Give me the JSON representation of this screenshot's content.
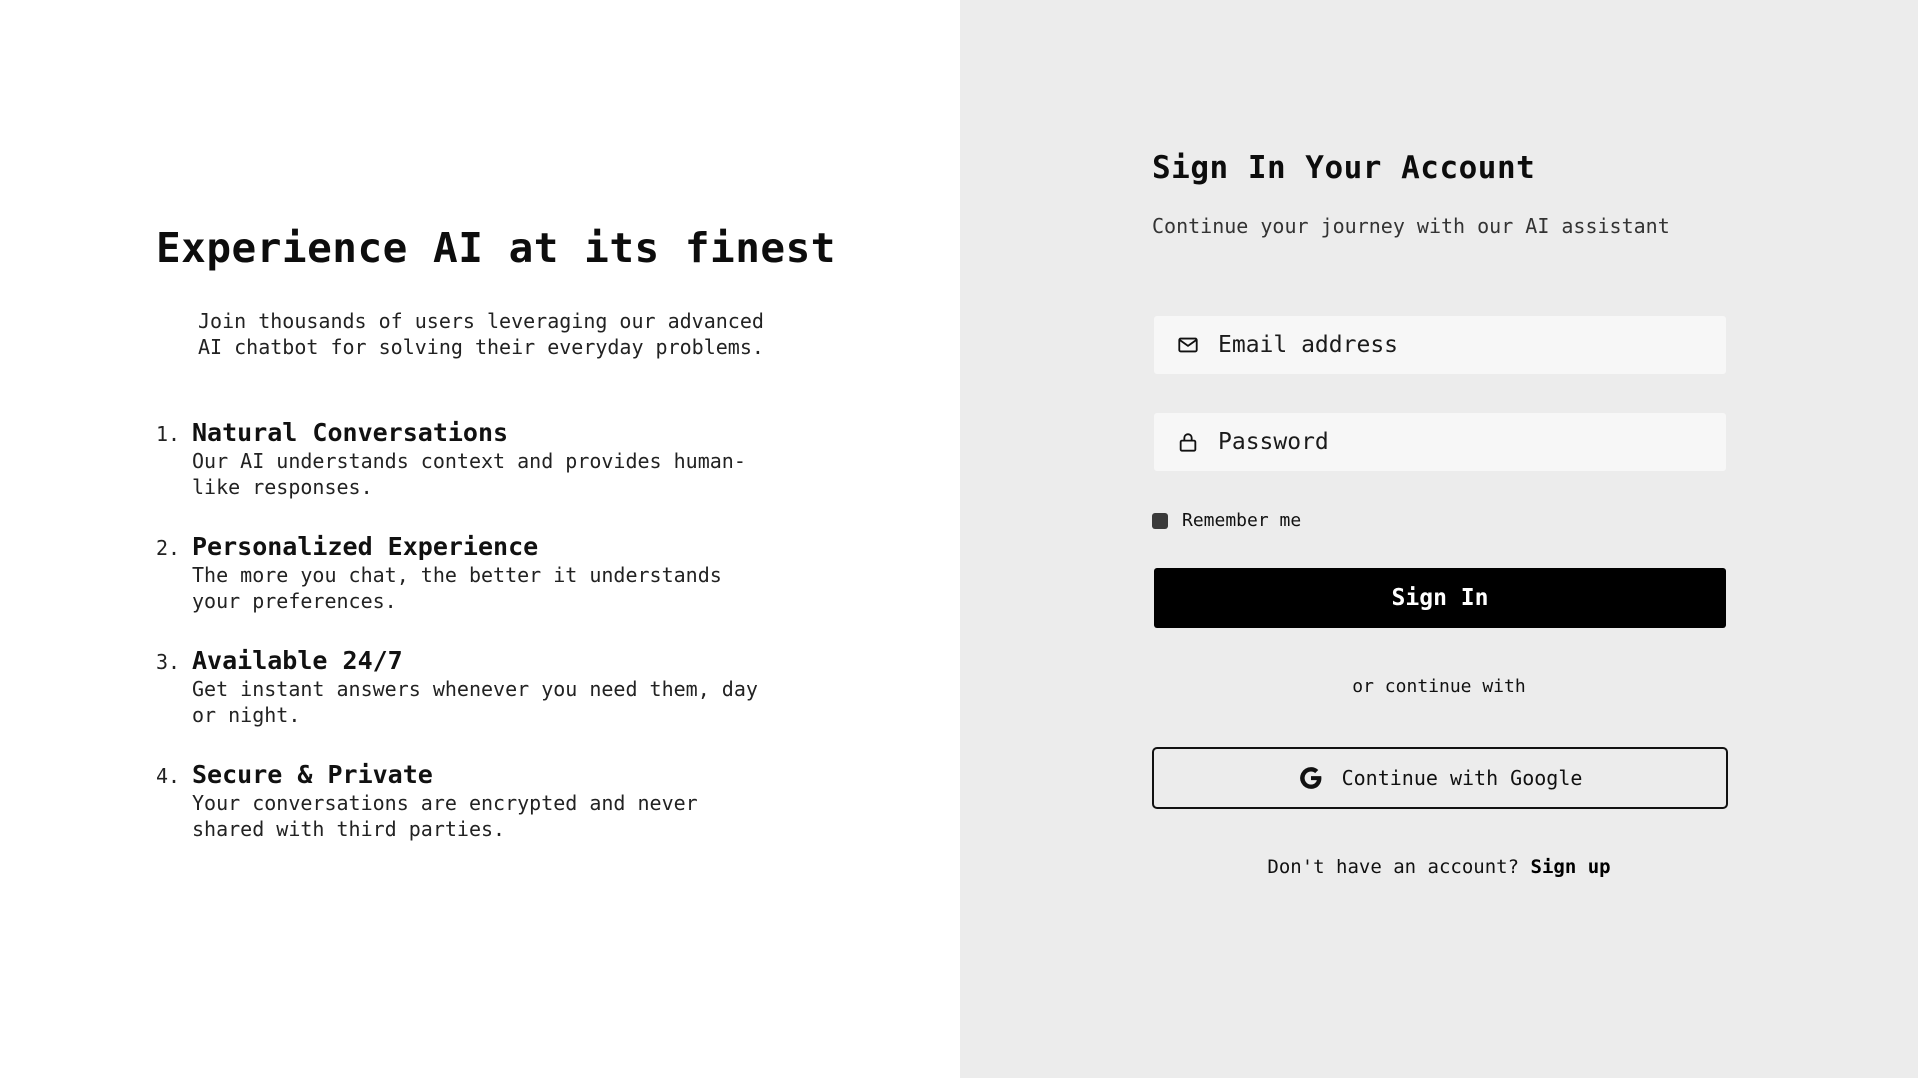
{
  "hero": {
    "title": "Experience AI at its finest",
    "subtitle": "Join thousands of users leveraging our advanced AI chatbot for solving their everyday problems."
  },
  "features": [
    {
      "number": "1.",
      "title": "Natural Conversations",
      "description": "Our AI understands context and provides human-like responses."
    },
    {
      "number": "2.",
      "title": "Personalized Experience",
      "description": "The more you chat, the better it understands your preferences."
    },
    {
      "number": "3.",
      "title": "Available 24/7",
      "description": "Get instant answers whenever you need them, day or night."
    },
    {
      "number": "4.",
      "title": "Secure & Private",
      "description": "Your conversations are encrypted and never shared with third parties."
    }
  ],
  "signin": {
    "title": "Sign In Your Account",
    "subtitle": "Continue your journey with our AI assistant",
    "email_placeholder": "Email address",
    "email_value": "",
    "password_placeholder": "Password",
    "password_value": "",
    "remember_label": "Remember me",
    "remember_checked": true,
    "submit_label": "Sign In",
    "divider_text": "or continue with",
    "google_label": "Continue with Google",
    "signup_prompt": "Don't have an account?",
    "signup_link": "Sign up"
  },
  "icons": {
    "email": "mail-icon",
    "password": "lock-icon",
    "google": "google-icon"
  },
  "colors": {
    "left_bg": "#ffffff",
    "right_bg": "#ececec",
    "field_bg": "#f7f7f7",
    "primary_button": "#000000",
    "text": "#111111"
  }
}
